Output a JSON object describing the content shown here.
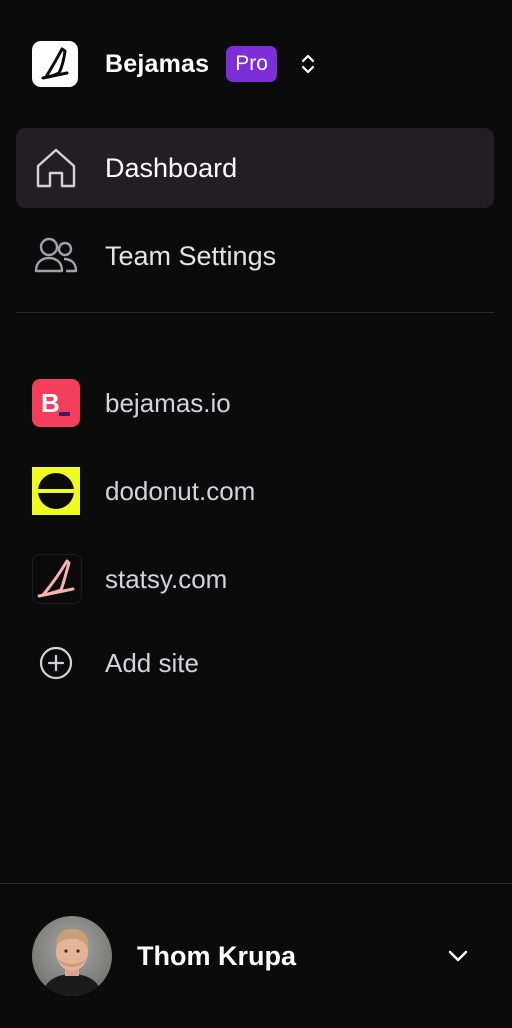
{
  "workspace": {
    "name": "Bejamas",
    "plan_badge": "Pro",
    "logo_icon": "bejamas-logo-icon",
    "switch_icon": "chevron-up-down-icon"
  },
  "nav": {
    "items": [
      {
        "label": "Dashboard",
        "icon": "home-icon",
        "active": true
      },
      {
        "label": "Team Settings",
        "icon": "users-icon",
        "active": false
      }
    ]
  },
  "sites": {
    "items": [
      {
        "label": "bejamas.io",
        "icon": "bejamas-favicon"
      },
      {
        "label": "dodonut.com",
        "icon": "dodonut-favicon"
      },
      {
        "label": "statsy.com",
        "icon": "statsy-favicon"
      }
    ],
    "add_label": "Add site",
    "add_icon": "plus-circle-icon"
  },
  "user": {
    "name": "Thom Krupa",
    "menu_icon": "chevron-down-icon"
  },
  "colors": {
    "background": "#0b0b0c",
    "active_item": "#211f24",
    "pro_badge": "#7c2fd6",
    "divider": "#2a2a2d",
    "bejamas_red": "#f33f5c",
    "dodonut_yellow": "#eefc1f",
    "statsy_pink": "#f6b2b0"
  }
}
